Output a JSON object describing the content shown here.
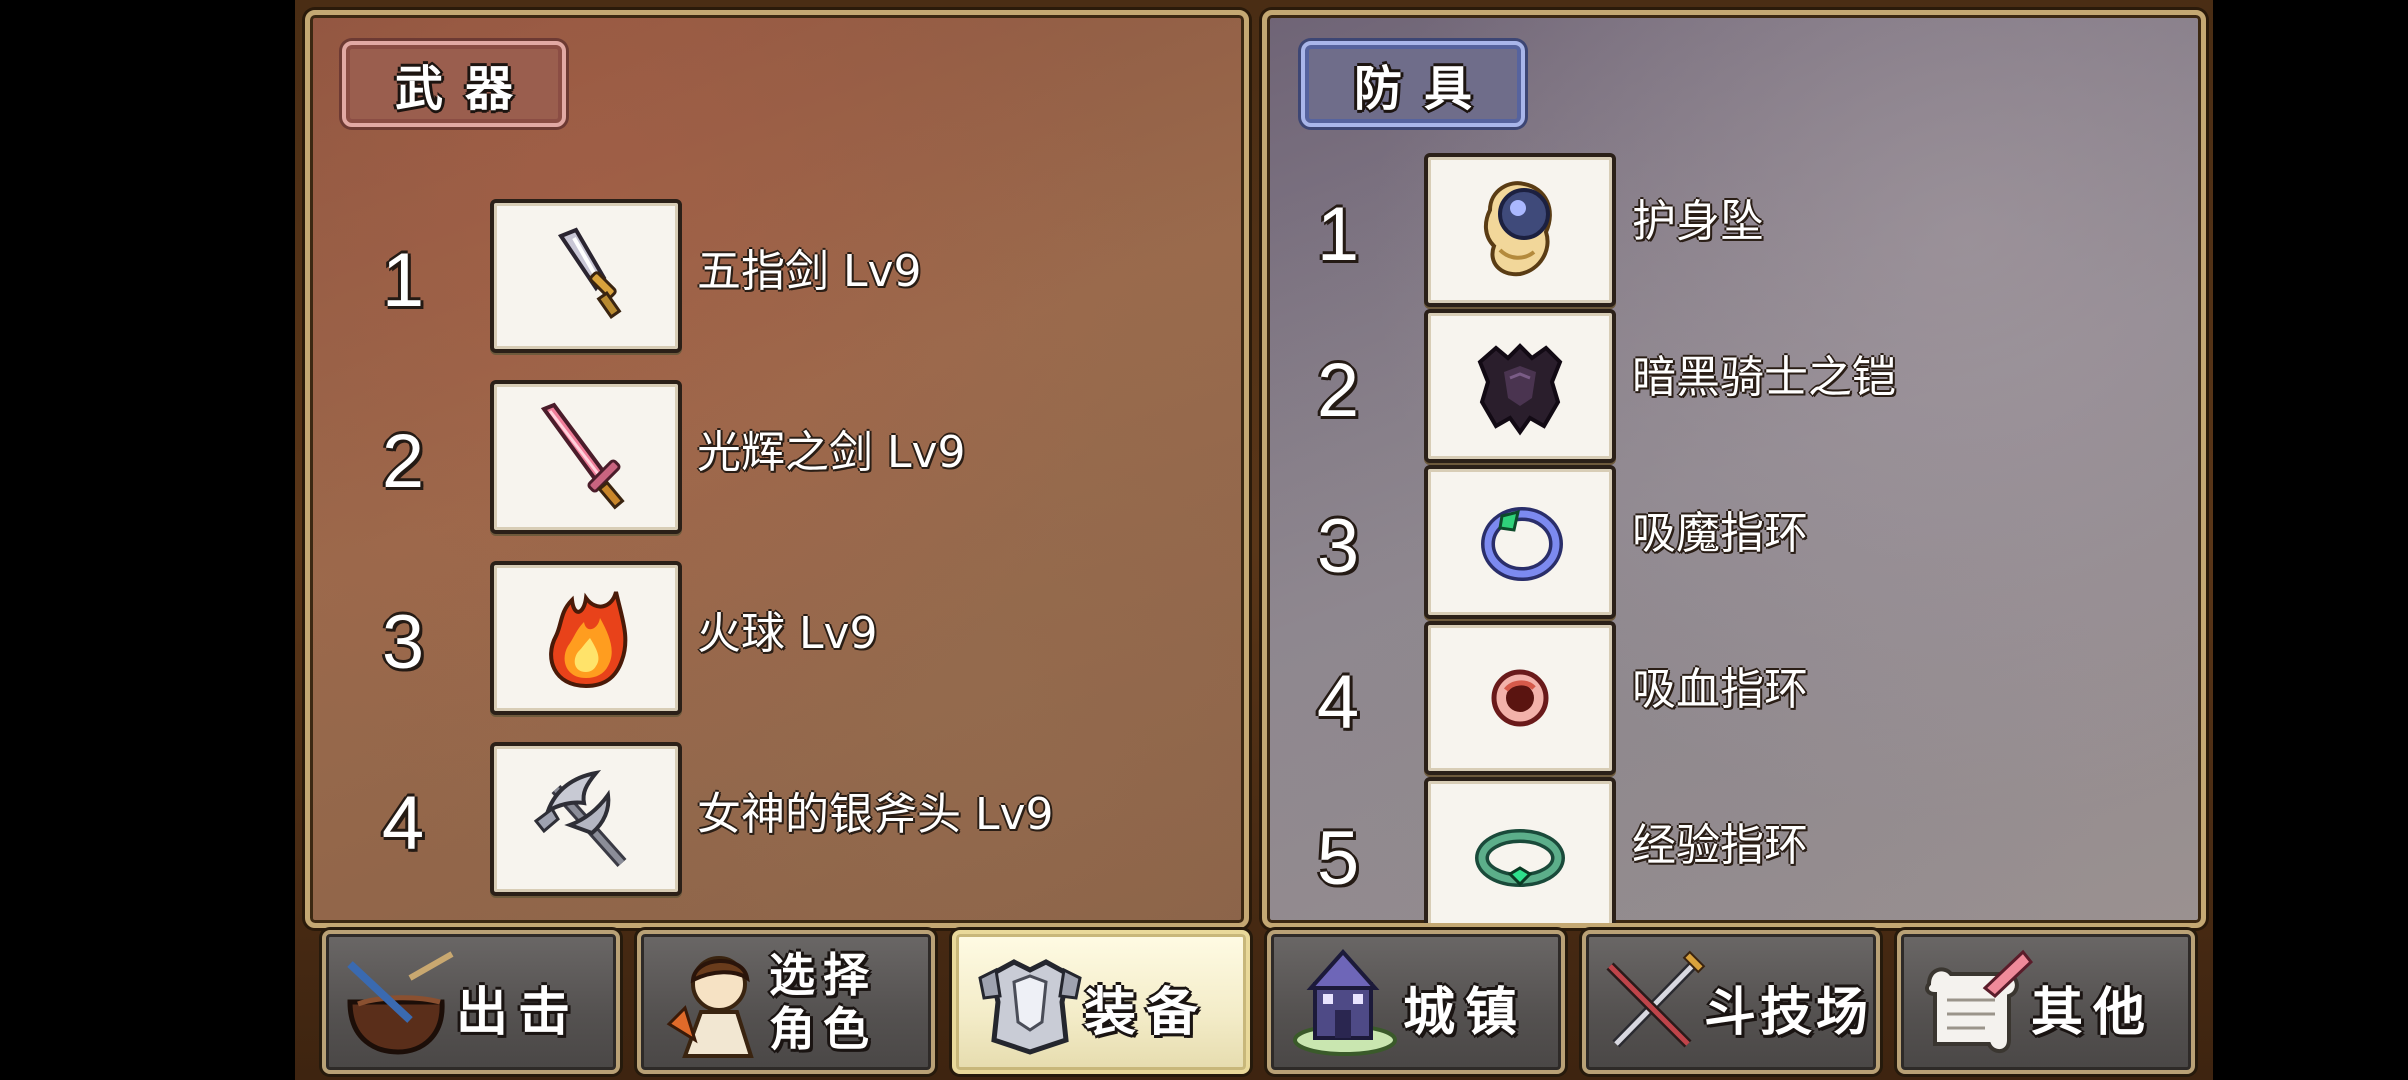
{
  "weapons": {
    "header": "武器",
    "items": [
      {
        "index": "1",
        "name": "五指剑 Lv9",
        "icon": "dagger-icon"
      },
      {
        "index": "2",
        "name": "光辉之剑 Lv9",
        "icon": "pink-sword-icon"
      },
      {
        "index": "3",
        "name": "火球 Lv9",
        "icon": "fireball-icon"
      },
      {
        "index": "4",
        "name": "女神的银斧头 Lv9",
        "icon": "silver-axe-icon"
      }
    ]
  },
  "armor": {
    "header": "防具",
    "items": [
      {
        "index": "1",
        "name": "护身坠",
        "icon": "amulet-icon"
      },
      {
        "index": "2",
        "name": "暗黑骑士之铠",
        "icon": "dark-armor-icon"
      },
      {
        "index": "3",
        "name": "吸魔指环",
        "icon": "magic-ring-icon"
      },
      {
        "index": "4",
        "name": "吸血指环",
        "icon": "blood-ring-icon"
      },
      {
        "index": "5",
        "name": "经验指环",
        "icon": "exp-ring-icon"
      }
    ]
  },
  "nav": [
    {
      "label": "出击",
      "icon": "pot-icon",
      "active": false
    },
    {
      "label_line1": "选择",
      "label_line2": "角色",
      "icon": "character-icon",
      "active": false
    },
    {
      "label": "装备",
      "icon": "armor-icon",
      "active": true
    },
    {
      "label": "城镇",
      "icon": "castle-icon",
      "active": false
    },
    {
      "label": "斗技场",
      "icon": "swords-icon",
      "active": false
    },
    {
      "label": "其他",
      "icon": "scroll-icon",
      "active": false
    }
  ],
  "colors": {
    "weapon_panel": "#8c5440",
    "armor_panel": "#8f8790",
    "frame_border": "#c4a873",
    "active_button": "#f3ecc8"
  }
}
